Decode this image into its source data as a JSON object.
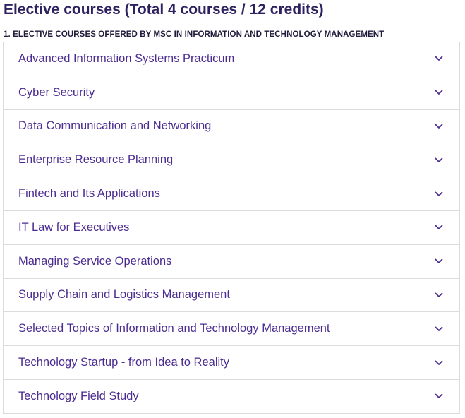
{
  "page": {
    "title": "Elective courses (Total 4 courses / 12 credits)",
    "section_heading": "1. ELECTIVE COURSES OFFERED BY MSC IN INFORMATION AND TECHNOLOGY MANAGEMENT"
  },
  "accordion": {
    "expand_icon": "chevron-down-icon",
    "items": [
      {
        "label": "Advanced Information Systems Practicum"
      },
      {
        "label": "Cyber Security"
      },
      {
        "label": "Data Communication and Networking"
      },
      {
        "label": "Enterprise Resource Planning"
      },
      {
        "label": "Fintech and Its Applications"
      },
      {
        "label": "IT Law for Executives"
      },
      {
        "label": "Managing Service Operations"
      },
      {
        "label": "Supply Chain and Logistics Management"
      },
      {
        "label": "Selected Topics of Information and Technology Management"
      },
      {
        "label": "Technology Startup - from Idea to Reality"
      },
      {
        "label": "Technology Field Study"
      }
    ]
  },
  "colors": {
    "title": "#2e2160",
    "item_text": "#4b2c91",
    "chevron": "#4b2c91",
    "border": "#dcdcdc"
  }
}
